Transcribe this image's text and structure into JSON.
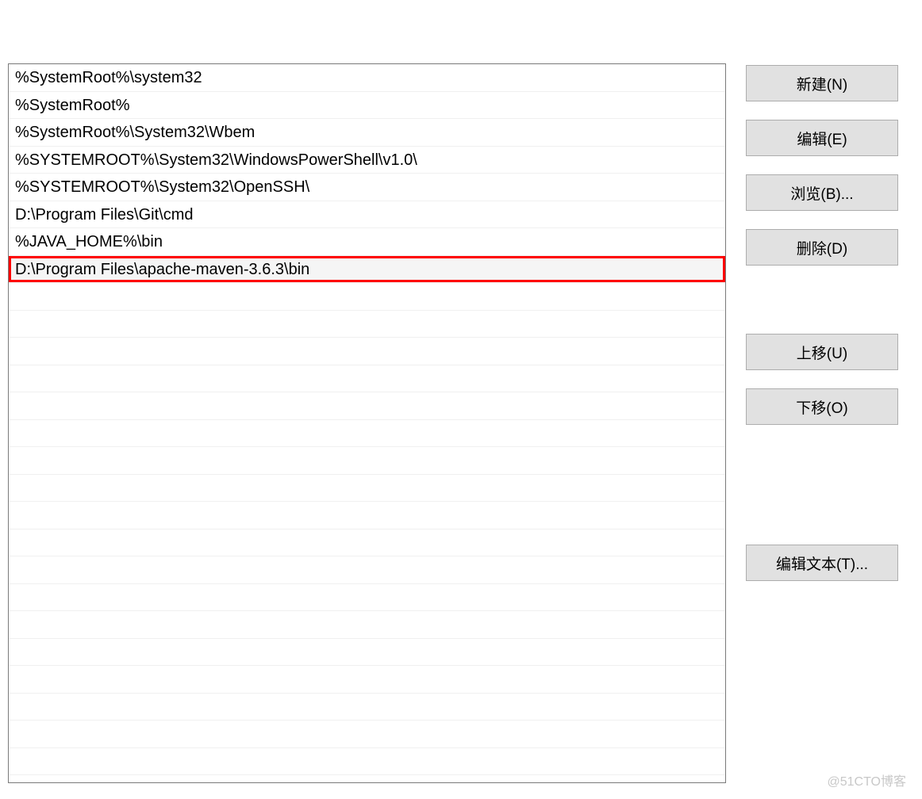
{
  "path_entries": [
    "%SystemRoot%\\system32",
    "%SystemRoot%",
    "%SystemRoot%\\System32\\Wbem",
    "%SYSTEMROOT%\\System32\\WindowsPowerShell\\v1.0\\",
    "%SYSTEMROOT%\\System32\\OpenSSH\\",
    "D:\\Program Files\\Git\\cmd",
    "%JAVA_HOME%\\bin",
    "D:\\Program Files\\apache-maven-3.6.3\\bin"
  ],
  "selected_index": 7,
  "highlighted_index": 7,
  "buttons": {
    "new": "新建(N)",
    "edit": "编辑(E)",
    "browse": "浏览(B)...",
    "delete": "删除(D)",
    "move_up": "上移(U)",
    "move_down": "下移(O)",
    "edit_text": "编辑文本(T)..."
  },
  "watermark": "@51CTO博客"
}
